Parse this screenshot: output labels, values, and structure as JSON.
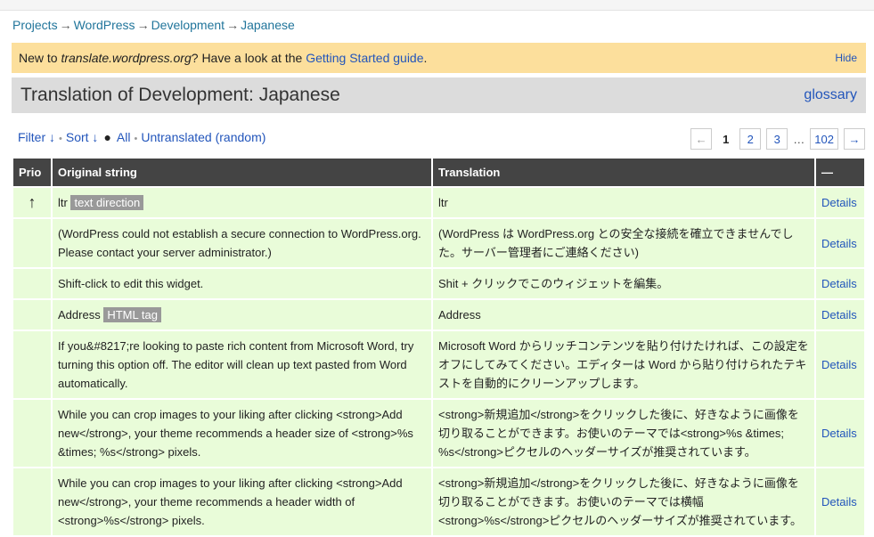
{
  "breadcrumb": {
    "items": [
      "Projects",
      "WordPress",
      "Development",
      "Japanese"
    ],
    "separator": "→"
  },
  "notice": {
    "text_before": "New to ",
    "site": "translate.wordpress.org",
    "text_after": "? Have a look at the ",
    "link": "Getting Started guide",
    "period": ".",
    "hide": "Hide"
  },
  "title": "Translation of Development: Japanese",
  "glossary": "glossary",
  "filters": {
    "filter": "Filter ↓",
    "sort": "Sort ↓",
    "all": "All",
    "untranslated": "Untranslated",
    "random": "(random)"
  },
  "pager": {
    "prev": "←",
    "current": "1",
    "p2": "2",
    "p3": "3",
    "ellipsis": "…",
    "last": "102",
    "next": "→"
  },
  "table": {
    "headers": {
      "prio": "Prio",
      "original": "Original string",
      "translation": "Translation",
      "actions": "—"
    },
    "rows": [
      {
        "prio": "↑",
        "original": "ltr",
        "badge": "text direction",
        "translation": "ltr",
        "details": "Details"
      },
      {
        "prio": "",
        "original": "(WordPress could not establish a secure connection to WordPress.org. Please contact your server administrator.)",
        "badge": "",
        "translation": "(WordPress は WordPress.org との安全な接続を確立できませんでした。サーバー管理者にご連絡ください)",
        "details": "Details"
      },
      {
        "prio": "",
        "original": "Shift-click to edit this widget.",
        "badge": "",
        "translation": "Shit + クリックでこのウィジェットを編集。",
        "details": "Details"
      },
      {
        "prio": "",
        "original": "Address",
        "badge": "HTML tag",
        "translation": "Address",
        "details": "Details"
      },
      {
        "prio": "",
        "original": "If you&#8217;re looking to paste rich content from Microsoft Word, try turning this option off. The editor will clean up text pasted from Word automatically.",
        "badge": "",
        "translation": "Microsoft Word からリッチコンテンツを貼り付けたければ、この設定をオフにしてみてください。エディターは Word から貼り付けられたテキストを自動的にクリーンアップします。",
        "details": "Details"
      },
      {
        "prio": "",
        "original": "While you can crop images to your liking after clicking <strong>Add new</strong>, your theme recommends a header size of <strong>%s &times; %s</strong> pixels.",
        "badge": "",
        "translation": "<strong>新規追加</strong>をクリックした後に、好きなように画像を切り取ることができます。お使いのテーマでは<strong>%s &times; %s</strong>ピクセルのヘッダーサイズが推奨されています。",
        "details": "Details"
      },
      {
        "prio": "",
        "original": "While you can crop images to your liking after clicking <strong>Add new</strong>, your theme recommends a header width of <strong>%s</strong> pixels.",
        "badge": "",
        "translation": "<strong>新規追加</strong>をクリックした後に、好きなように画像を切り取ることができます。お使いのテーマでは横幅<strong>%s</strong>ピクセルのヘッダーサイズが推奨されています。",
        "details": "Details"
      }
    ]
  }
}
